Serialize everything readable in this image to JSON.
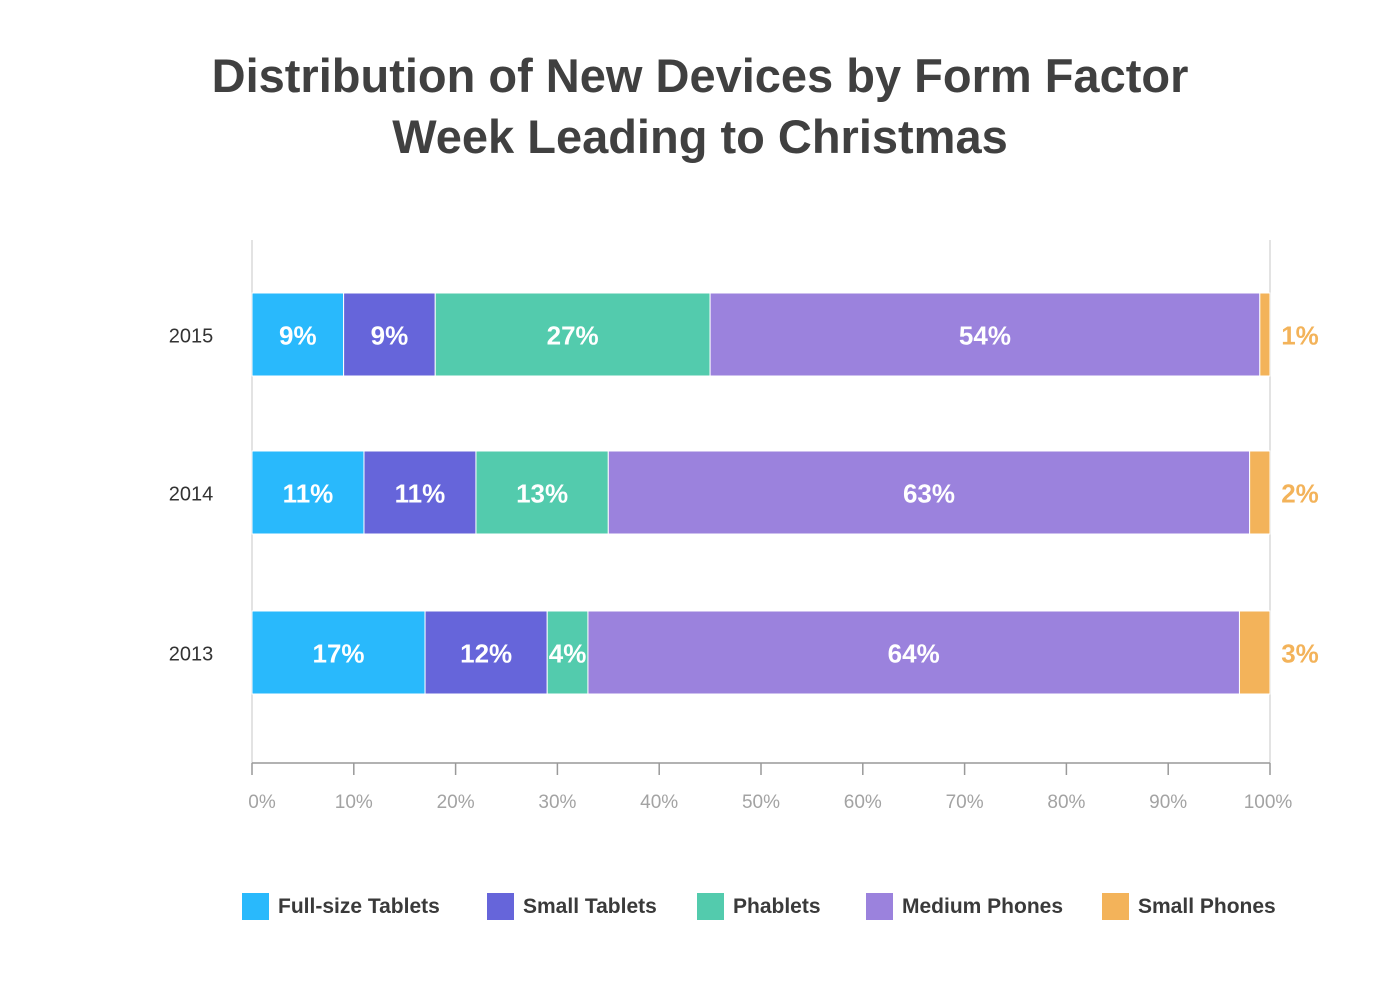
{
  "chart_data": {
    "type": "bar",
    "orientation": "horizontal",
    "stacked": true,
    "title": "Distribution of New Devices by Form Factor",
    "subtitle": "Week Leading to Christmas",
    "xlabel": "",
    "ylabel": "",
    "xlim": [
      0,
      100
    ],
    "x_ticks": [
      "0%",
      "10%",
      "20%",
      "30%",
      "40%",
      "50%",
      "60%",
      "70%",
      "80%",
      "90%",
      "100%"
    ],
    "categories": [
      "2015",
      "2014",
      "2013"
    ],
    "series": [
      {
        "name": "Full-size Tablets",
        "color": "#29B9FC",
        "values": [
          9,
          11,
          17
        ],
        "labels": [
          "9%",
          "11%",
          "17%"
        ]
      },
      {
        "name": "Small Tablets",
        "color": "#6665DA",
        "values": [
          9,
          11,
          12
        ],
        "labels": [
          "9%",
          "11%",
          "12%"
        ]
      },
      {
        "name": "Phablets",
        "color": "#53CBAD",
        "values": [
          27,
          13,
          4
        ],
        "labels": [
          "27%",
          "13%",
          "4%"
        ]
      },
      {
        "name": "Medium Phones",
        "color": "#9B82DD",
        "values": [
          54,
          63,
          64
        ],
        "labels": [
          "54%",
          "63%",
          "64%"
        ]
      },
      {
        "name": "Small Phones",
        "color": "#F3B35A",
        "values": [
          1,
          2,
          3
        ],
        "labels": [
          "1%",
          "2%",
          "3%"
        ]
      }
    ],
    "legend_position": "bottom",
    "grid": false
  }
}
